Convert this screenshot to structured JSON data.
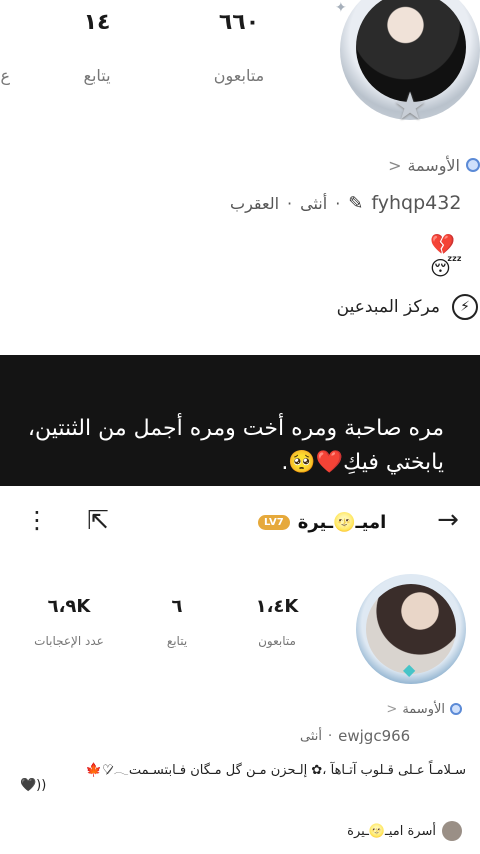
{
  "top_profile": {
    "stats": [
      {
        "value": "٦٦٠",
        "label": "متابعون"
      },
      {
        "value": "١٤",
        "label": "يتابع"
      },
      {
        "value": "",
        "label": "ع"
      }
    ],
    "badges_link": "الأوسمة",
    "chevron": "<",
    "username": "fyhqp432",
    "gender": "أنثى",
    "zodiac": "العقرب",
    "dot": "·",
    "status_emojis": "💔😴",
    "creator_center": "مركز المبدعين"
  },
  "banner": {
    "text": "مره صاحبة ومره أخت ومره أجمل من الثنتين، يابختي فيكِ❤️🥺."
  },
  "bottom_profile": {
    "display_name": "اميـ🌝ـيرة",
    "level_badge": "LV7",
    "stats": [
      {
        "value": "١،٤K",
        "label": "متابعون"
      },
      {
        "value": "٦",
        "label": "يتابع"
      },
      {
        "value": "٦،٩K",
        "label": "عدد الإعجابات"
      }
    ],
    "badges_link": "الأوسمة",
    "chevron": "<",
    "username": "ewjgc966",
    "gender": "أنثى",
    "dot": "·",
    "bio_line1": "سـلامـاً عـلى قـلوب آتـاهآ ،‏⁦✿⁩ إلـحزن مـن گل مـگان فـابتسـمت𓂃♡̷🍁",
    "bio_line2": "((🖤",
    "family": "أسرة اميـ🌝ـيرة"
  },
  "icons": {
    "back": "arrow-left-icon",
    "share": "share-icon",
    "more": "more-vertical-icon",
    "badge": "badge-icon",
    "edit": "edit-icon",
    "creator": "lightning-icon",
    "diamond": "diamond-icon"
  }
}
